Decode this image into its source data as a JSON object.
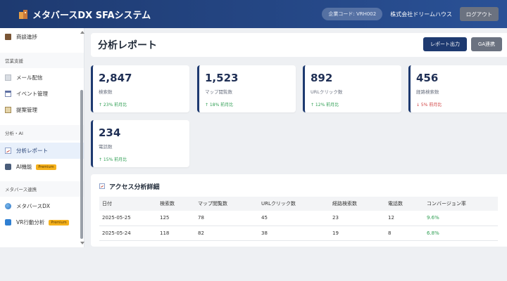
{
  "header": {
    "app_title": "メタバースDX SFAシステム",
    "company_code": "企業コード: VRH002",
    "company_name": "株式会社ドリームハウス",
    "logout_label": "ログアウト"
  },
  "sidebar": {
    "items": [
      {
        "type": "item",
        "label": "商談進捗",
        "icon": "briefcase-icon"
      },
      {
        "type": "section",
        "label": "営業支援"
      },
      {
        "type": "item",
        "label": "メール配信",
        "icon": "mail-icon"
      },
      {
        "type": "item",
        "label": "イベント管理",
        "icon": "calendar-icon"
      },
      {
        "type": "item",
        "label": "提案管理",
        "icon": "clipboard-icon"
      },
      {
        "type": "section",
        "label": "分析・AI"
      },
      {
        "type": "item",
        "label": "分析レポート",
        "icon": "chart-icon",
        "active": true
      },
      {
        "type": "item",
        "label": "AI機能",
        "icon": "robot-icon",
        "badge": "Premium"
      },
      {
        "type": "section",
        "label": "メタバース連携"
      },
      {
        "type": "item",
        "label": "メタバースDX",
        "icon": "globe-icon"
      },
      {
        "type": "item",
        "label": "VR行動分析",
        "icon": "vr-icon",
        "badge": "Premium"
      }
    ]
  },
  "page": {
    "title": "分析レポート",
    "report_button": "レポート出力",
    "ga_button": "GA連携"
  },
  "stats": [
    {
      "value": "2,847",
      "label": "検索数",
      "change": "↑ 23% 前月比",
      "trend": "up"
    },
    {
      "value": "1,523",
      "label": "マップ閲覧数",
      "change": "↑ 18% 前月比",
      "trend": "up"
    },
    {
      "value": "892",
      "label": "URLクリック数",
      "change": "↑ 12% 前月比",
      "trend": "up"
    },
    {
      "value": "456",
      "label": "経路検索数",
      "change": "↓ 5% 前月比",
      "trend": "down"
    },
    {
      "value": "234",
      "label": "電話数",
      "change": "↑ 15% 前月比",
      "trend": "up"
    }
  ],
  "table": {
    "title": "アクセス分析詳細",
    "columns": [
      "日付",
      "検索数",
      "マップ閲覧数",
      "URLクリック数",
      "経路検索数",
      "電話数",
      "コンバージョン率"
    ],
    "rows": [
      [
        "2025-05-25",
        "125",
        "78",
        "45",
        "23",
        "12",
        "9.6%"
      ],
      [
        "2025-05-24",
        "118",
        "82",
        "38",
        "19",
        "8",
        "6.8%"
      ]
    ]
  },
  "colors": {
    "header_bg": "#1e3a70",
    "accent": "#1e3a70",
    "up": "#2e9e52",
    "down": "#d04040",
    "premium": "#f5b11c"
  }
}
